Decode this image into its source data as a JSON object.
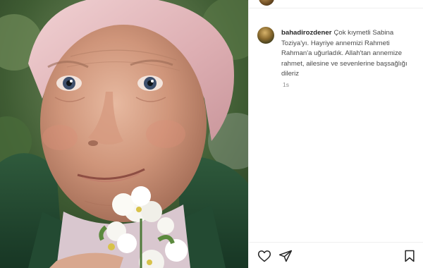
{
  "post": {
    "username": "bahadirozdener",
    "caption": "Çok kıymetli Sabina Toziya'yı. Hayriye annemizi Rahmeti Rahman'a uğurladık. Allah'tan annemize rahmet, ailesine ve sevenlerine başsağlığı dileriz",
    "time": "1s"
  },
  "icons": {
    "like": "heart-icon",
    "share": "send-icon",
    "save": "bookmark-icon"
  },
  "colors": {
    "text": "#262626",
    "muted": "#8e8e8e",
    "border": "#efefef"
  }
}
